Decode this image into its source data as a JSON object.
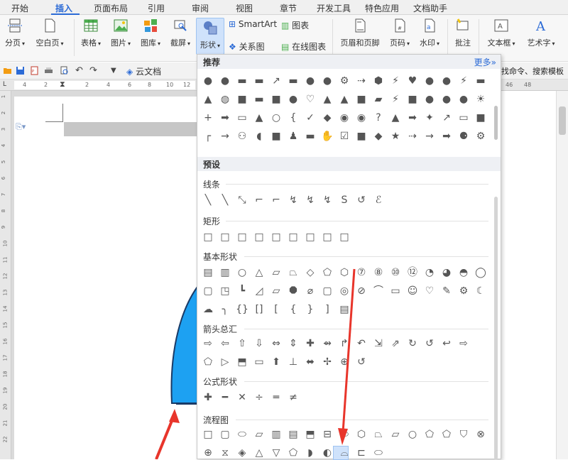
{
  "menu": {
    "tabs": [
      "开始",
      "插入",
      "页面布局",
      "引用",
      "审阅",
      "视图",
      "章节",
      "开发工具",
      "特色应用",
      "文档助手"
    ],
    "active_index": 1
  },
  "ribbon": {
    "fenye": "分页",
    "kongbaiye": "空白页",
    "biaoge": "表格",
    "tupian": "图片",
    "tuku": "图库",
    "jieping": "截屏",
    "xingzhuang": "形状",
    "smartart": "SmartArt",
    "tubiao": "图表",
    "guanxitu": "关系图",
    "zaixiantubiao": "在线图表",
    "yemei": "页眉和页脚",
    "yema": "页码",
    "shuiyin": "水印",
    "pizhu": "批注",
    "wenbenkuang": "文本框",
    "yishuzi": "艺术字"
  },
  "quickbar": {
    "cloud_doc": "云文档",
    "hint": "找命令、搜索模板"
  },
  "ruler": {
    "h_ticks": [
      "4",
      "2",
      "2",
      "4",
      "6",
      "8",
      "10",
      "12"
    ],
    "right_ticks": [
      "46",
      "48"
    ],
    "v_ticks": [
      "1",
      "2",
      "3",
      "4",
      "5",
      "6",
      "7",
      "8",
      "9",
      "10",
      "11",
      "12",
      "13",
      "14",
      "15",
      "16",
      "17",
      "18",
      "19",
      "20",
      "21",
      "22"
    ]
  },
  "panel": {
    "recommended": "推荐",
    "more": "更多»",
    "presets": "预设",
    "lines": "线条",
    "rect": "矩形",
    "basic": "基本形状",
    "arrows": "箭头总汇",
    "formula": "公式形状",
    "flowchart": "流程图"
  },
  "colors": {
    "accent": "#2c6bd6",
    "shape_fill": "#1da1f2",
    "arrow_red": "#e8352b",
    "selected_bg": "#cfe2fb"
  }
}
